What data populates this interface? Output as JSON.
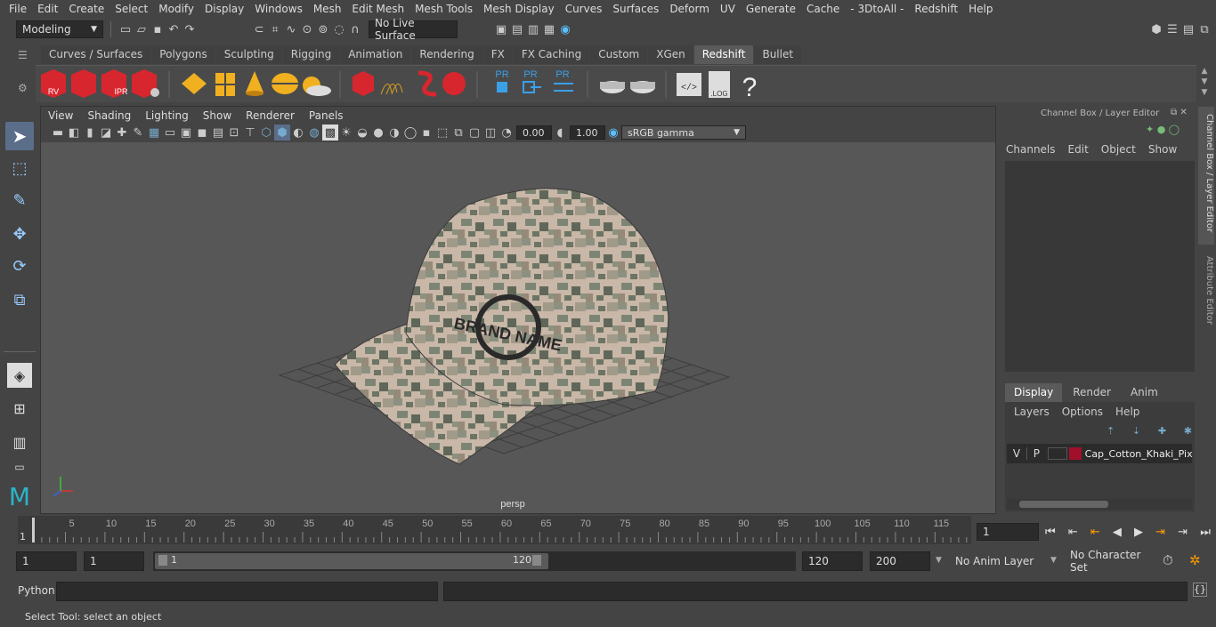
{
  "menu": [
    "File",
    "Edit",
    "Create",
    "Select",
    "Modify",
    "Display",
    "Windows",
    "Mesh",
    "Edit Mesh",
    "Mesh Tools",
    "Mesh Display",
    "Curves",
    "Surfaces",
    "Deform",
    "UV",
    "Generate",
    "Cache",
    "- 3DtoAll -",
    "Redshift",
    "Help"
  ],
  "status": {
    "mode": "Modeling",
    "live_surface": "No Live Surface"
  },
  "shelf_tabs": [
    "Curves / Surfaces",
    "Polygons",
    "Sculpting",
    "Rigging",
    "Animation",
    "Rendering",
    "FX",
    "FX Caching",
    "Custom",
    "XGen",
    "Redshift",
    "Bullet"
  ],
  "shelf_active": "Redshift",
  "shelf_icon_labels": {
    "rv": "RV",
    "ipr": "IPR",
    "pr1": "PR",
    "pr2": "PR",
    "pr3": "PR",
    "log": ".LOG",
    "help": "?"
  },
  "viewport": {
    "menu": [
      "View",
      "Shading",
      "Lighting",
      "Show",
      "Renderer",
      "Panels"
    ],
    "exposure": "0.00",
    "gamma": "1.00",
    "colorspace": "sRGB gamma",
    "camera": "persp",
    "cap_text": "BRAND NAME"
  },
  "right_panel": {
    "title": "Channel Box / Layer Editor",
    "menu": [
      "Channels",
      "Edit",
      "Object",
      "Show"
    ],
    "tabs": [
      "Display",
      "Render",
      "Anim"
    ],
    "active_tab": "Display",
    "layer_menu": [
      "Layers",
      "Options",
      "Help"
    ],
    "layer": {
      "v": "V",
      "p": "P",
      "name": "Cap_Cotton_Khaki_Pix",
      "color": "#a0102a"
    },
    "side_tabs": [
      "Channel Box / Layer Editor",
      "Attribute Editor"
    ]
  },
  "timeline": {
    "ticks": [
      "5",
      "10",
      "15",
      "20",
      "25",
      "30",
      "35",
      "40",
      "45",
      "50",
      "55",
      "60",
      "65",
      "70",
      "75",
      "80",
      "85",
      "90",
      "95",
      "100",
      "105",
      "110",
      "115",
      "12"
    ],
    "start_marker": "1",
    "current_frame": "1"
  },
  "range": {
    "start": "1",
    "start2": "1",
    "slider_start": "1",
    "slider_end": "120",
    "end": "120",
    "end2": "200",
    "anim_layer": "No Anim Layer",
    "char_set": "No Character Set"
  },
  "cmd": {
    "label": "Python"
  },
  "help": "Select Tool: select an object"
}
